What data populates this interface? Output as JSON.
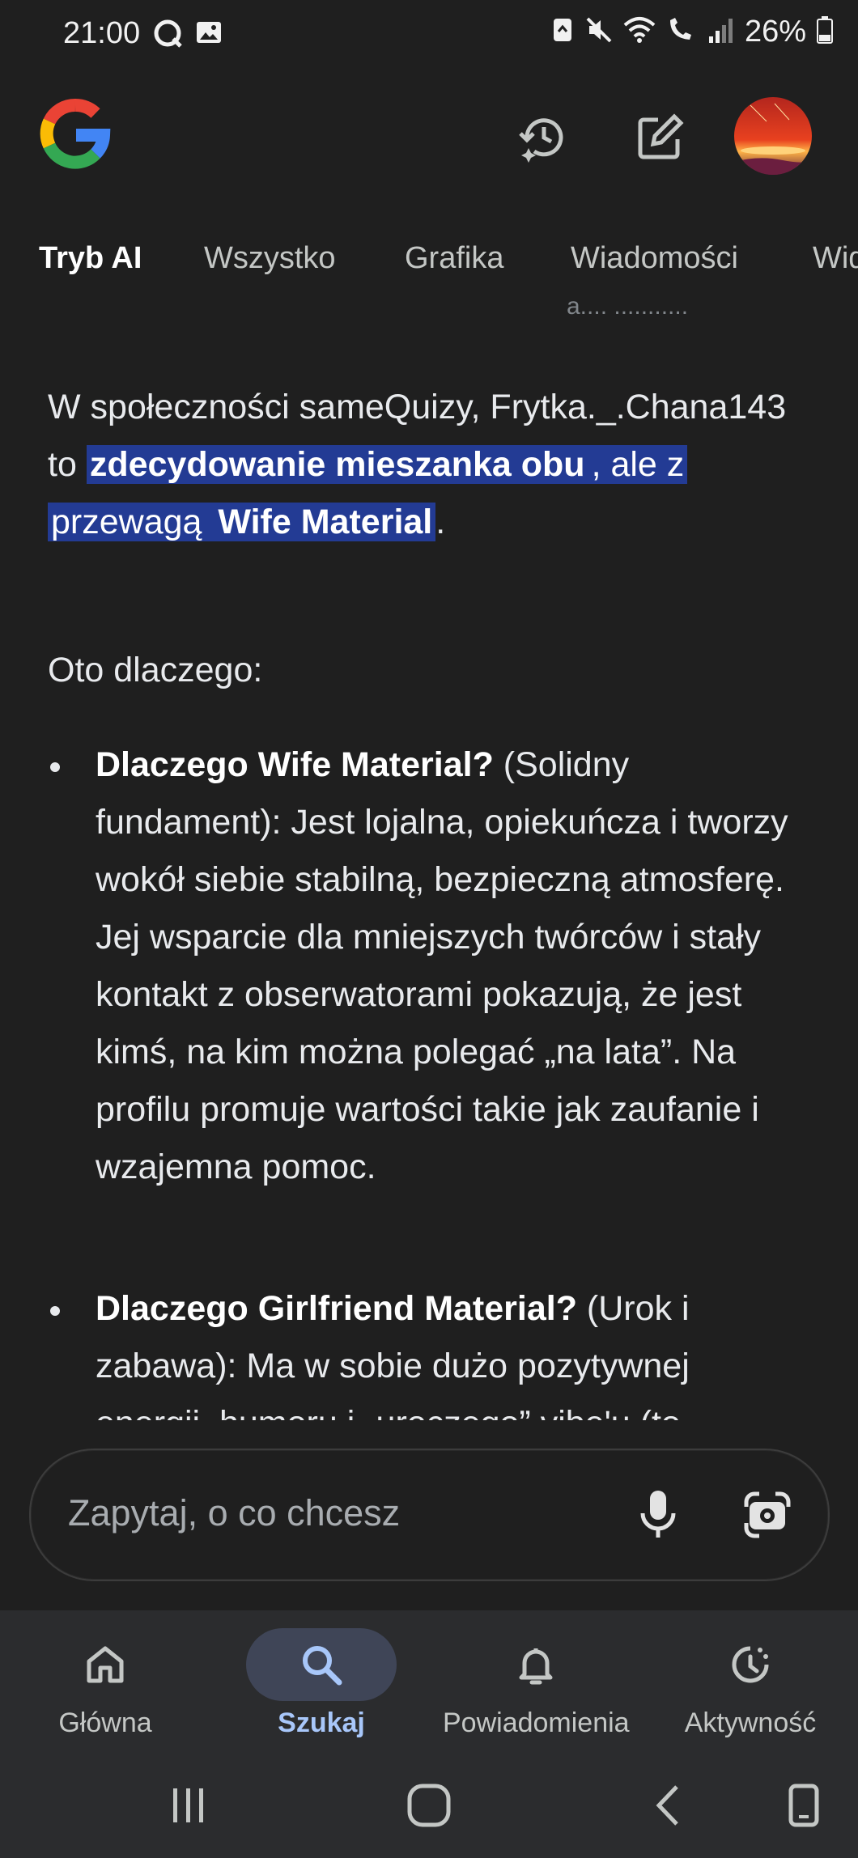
{
  "status_bar": {
    "time": "21:00",
    "battery": "26%",
    "icons": [
      "q-icon",
      "gallery-icon",
      "recycle-icon",
      "mute-icon",
      "wifi-icon",
      "wifi-calling-icon",
      "signal-icon",
      "battery-icon"
    ]
  },
  "header": {
    "logo": "google-logo",
    "history_icon": "history-icon",
    "new_chat_icon": "edit-icon",
    "avatar": "avatar"
  },
  "tabs": [
    {
      "label": "Tryb AI",
      "active": true
    },
    {
      "label": "Wszystko",
      "active": false
    },
    {
      "label": "Grafika",
      "active": false
    },
    {
      "label": "Wiadomości",
      "active": false
    },
    {
      "label": "Wid",
      "active": false
    }
  ],
  "content": {
    "clipped_top_line": "a....  ...........",
    "intro": {
      "text_before": "W społeczności sameQuizy, Frytka._.Chana143 to ",
      "highlight_bold_1": "zdecydowanie mieszanka obu",
      "highlight_plain": ", ale z przewagą ",
      "highlight_bold_2": "Wife Material",
      "text_after": "."
    },
    "lead": "Oto dlaczego:",
    "items": [
      {
        "title": "Dlaczego Wife Material?",
        "text": " (Solidny fundament): Jest lojalna, opiekuńcza i tworzy wokół siebie stabilną, bezpieczną atmosferę. Jej wsparcie dla mniejszych twórców i stały kontakt z obserwatorami pokazują, że jest kimś, na kim można polegać „na lata”. Na profilu promuje wartości takie jak zaufanie i wzajemna pomoc."
      },
      {
        "title": "Dlaczego Girlfriend Material?",
        "text": " (Urok i zabawa): Ma w sobie dużo pozytywnej energii, humoru i „uroczego” vibe'u (to"
      }
    ]
  },
  "search": {
    "placeholder": "Zapytaj, o co chcesz",
    "mic_icon": "mic-icon",
    "lens_icon": "google-lens-icon"
  },
  "bottom_nav": [
    {
      "label": "Główna",
      "icon": "home-icon",
      "active": false
    },
    {
      "label": "Szukaj",
      "icon": "search-icon",
      "active": true
    },
    {
      "label": "Powiadomienia",
      "icon": "bell-icon",
      "active": false
    },
    {
      "label": "Aktywność",
      "icon": "activity-icon",
      "active": false
    }
  ],
  "system_nav": [
    "recents-button",
    "home-button",
    "back-button",
    "rotate-button"
  ],
  "colors": {
    "background": "#1f1f1f",
    "highlight": "#233b94",
    "active_nav": "#a8c7fa",
    "nav_bar": "#2b2c2e"
  }
}
